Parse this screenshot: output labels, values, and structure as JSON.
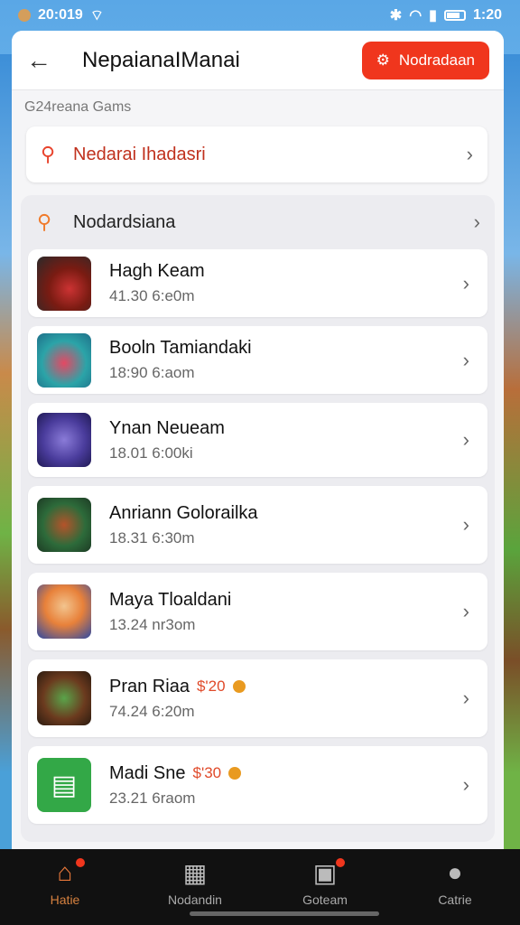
{
  "status": {
    "time_left": "20:019",
    "time_right": "1:20"
  },
  "header": {
    "title": "NepaianaIManai",
    "action_label": "Nodradaan",
    "back_icon": "back-arrow-icon",
    "action_icon": "gear-icon",
    "accent": "#f0361d"
  },
  "section_label": "G24reana Gams",
  "search": {
    "label": "Nedarai Ihadasri"
  },
  "group": {
    "title": "Nodardsiana"
  },
  "items": [
    {
      "name": "Hagh Keam",
      "sub": "41.30 6:e0m",
      "price": ""
    },
    {
      "name": "Booln Tamiandaki",
      "sub": "18:90 6:aom",
      "price": ""
    },
    {
      "name": "Ynan Neueam",
      "sub": "18.01 6:00ki",
      "price": ""
    },
    {
      "name": "Anriann Golorailka",
      "sub": "18.31 6:30m",
      "price": ""
    },
    {
      "name": "Maya Tloaldani",
      "sub": "13.24 nr3om",
      "price": ""
    },
    {
      "name": "Pran Riaa",
      "sub": "74.24 6:20m",
      "price": "$'20"
    },
    {
      "name": "Madi Sne",
      "sub": "23.21 6raom",
      "price": "$'30"
    }
  ],
  "nav": [
    {
      "label": "Hatie",
      "icon": "home-icon"
    },
    {
      "label": "Nodandin",
      "icon": "shop-icon"
    },
    {
      "label": "Goteam",
      "icon": "book-icon"
    },
    {
      "label": "Catrie",
      "icon": "person-icon"
    }
  ]
}
